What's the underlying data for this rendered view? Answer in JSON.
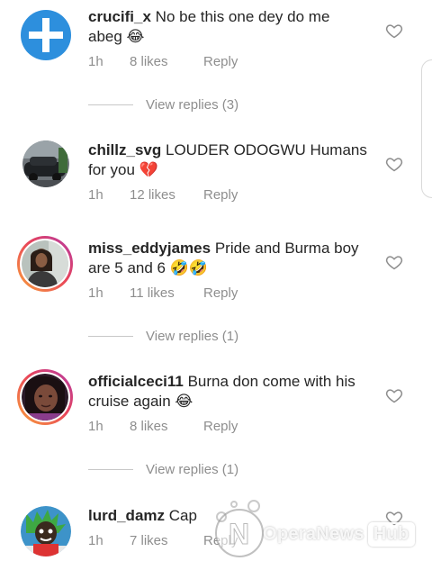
{
  "comments": [
    {
      "username": "crucifi_x",
      "text": "No be this one dey do me abeg 😂",
      "time": "1h",
      "likes": "8 likes",
      "reply": "Reply",
      "avatar_icon": "cross-plus-icon",
      "view_replies": "View replies (3)"
    },
    {
      "username": "chillz_svg",
      "text": "LOUDER ODOGWU Humans for you 💔",
      "time": "1h",
      "likes": "12 likes",
      "reply": "Reply",
      "avatar_icon": "car-photo"
    },
    {
      "username": "miss_eddyjames",
      "text": "Pride and Burma boy are 5 and 6 🤣🤣",
      "time": "1h",
      "likes": "11 likes",
      "reply": "Reply",
      "avatar_icon": "portrait-photo",
      "view_replies": "View replies (1)"
    },
    {
      "username": "officialceci11",
      "text": "Burna don come with his cruise again 😂",
      "time": "1h",
      "likes": "8 likes",
      "reply": "Reply",
      "avatar_icon": "portrait-photo",
      "view_replies": "View replies (1)"
    },
    {
      "username": "lurd_damz",
      "text": "Cap",
      "time": "1h",
      "likes": "7 likes",
      "reply": "Reply",
      "avatar_icon": "cartoon-photo"
    }
  ],
  "watermark": {
    "text": "OperaNews",
    "badge": "Hub"
  },
  "colors": {
    "text": "#262626",
    "secondary": "#8e8e8e",
    "avatar_blue": "#2d8fdd",
    "story_ring_start": "#f9a23a",
    "story_ring_end": "#b43aa6"
  }
}
